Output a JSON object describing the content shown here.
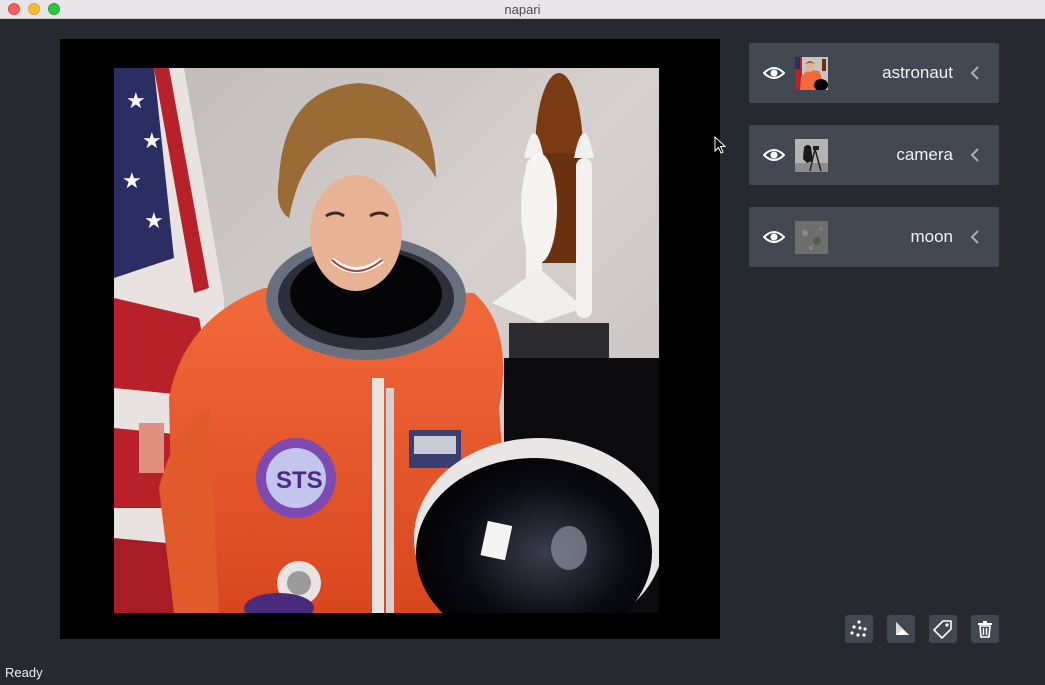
{
  "window": {
    "title": "napari"
  },
  "canvas": {
    "image_layer": "astronaut"
  },
  "layers": [
    {
      "name": "astronaut",
      "visible": true,
      "eye_icon": "eye-icon",
      "chevron_icon": "chevron-left-icon"
    },
    {
      "name": "camera",
      "visible": true,
      "eye_icon": "eye-icon",
      "chevron_icon": "chevron-left-icon"
    },
    {
      "name": "moon",
      "visible": true,
      "eye_icon": "eye-icon",
      "chevron_icon": "chevron-left-icon"
    }
  ],
  "toolbar": {
    "buttons": [
      {
        "icon": "points-icon"
      },
      {
        "icon": "shapes-icon"
      },
      {
        "icon": "labels-icon"
      },
      {
        "icon": "trash-icon"
      }
    ]
  },
  "status_bar": {
    "text": "Ready"
  },
  "colors": {
    "background": "#262930",
    "panel": "#414851",
    "text": "#f0f1f2"
  }
}
